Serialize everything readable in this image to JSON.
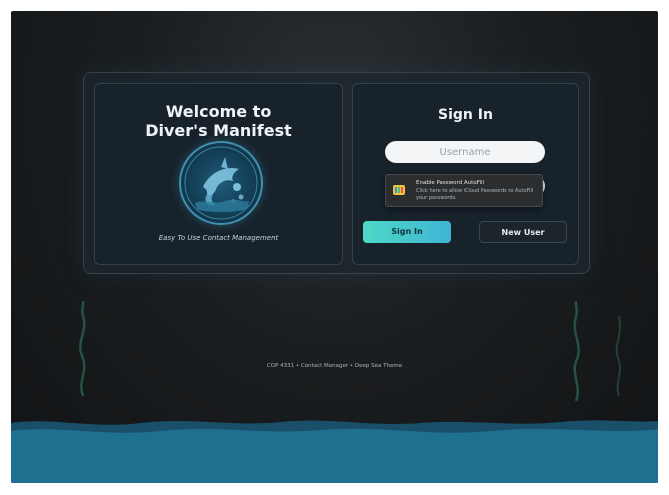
{
  "left_panel": {
    "welcome_line1": "Welcome to",
    "welcome_line2": "Diver's Manifest",
    "logo_icon": "shark-diver-logo-icon",
    "tagline": "Easy To Use Contact Management"
  },
  "sign_in": {
    "title": "Sign In",
    "username_placeholder": "Username",
    "username_value": "",
    "autofill": {
      "title": "Enable Password AutoFill",
      "description": "Click here to allow iCloud Passwords to AutoFill your passwords."
    },
    "signin_button": "Sign In",
    "new_user_button": "New User"
  },
  "footer": {
    "text": "COP 4331 • Contact Manager • Deep Sea Theme"
  },
  "colors": {
    "accent": "#4fd8c8",
    "ocean": "#1f6f90",
    "card_bg": "#17222b"
  }
}
